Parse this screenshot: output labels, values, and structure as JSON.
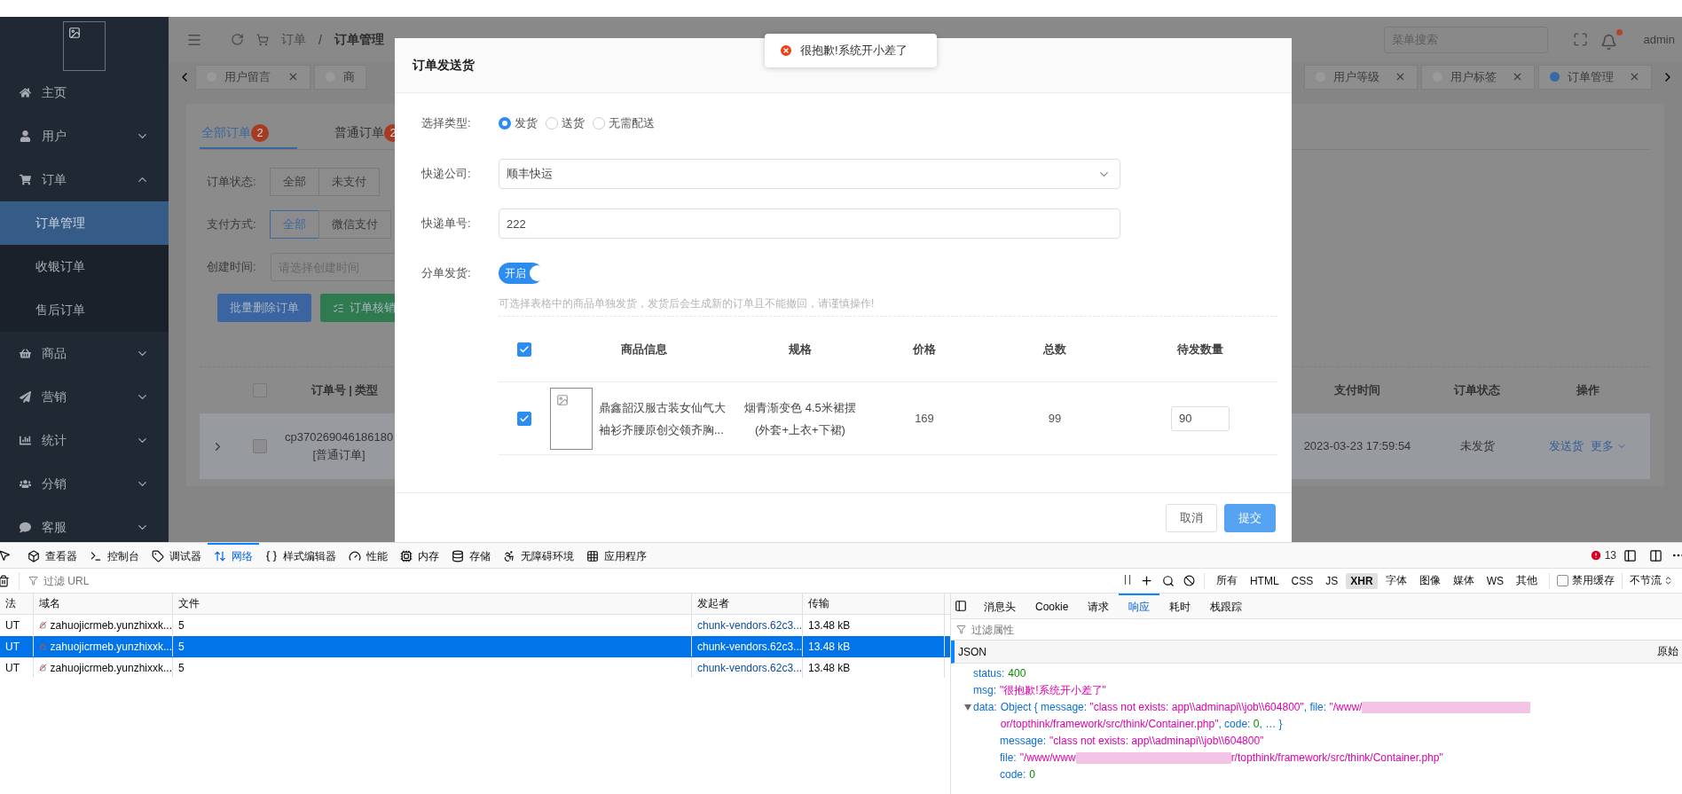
{
  "header": {
    "breadcrumb": {
      "items": [
        "订单",
        "订单管理"
      ],
      "separator": "/"
    },
    "search": {
      "placeholder": "菜单搜索"
    },
    "unread": true,
    "user": "admin"
  },
  "tabs": {
    "left": [
      {
        "label": "用户留言",
        "selected": false
      },
      {
        "label": "商",
        "selected": false
      }
    ],
    "right": [
      {
        "label": "用户等级",
        "selected": false
      },
      {
        "label": "用户标签",
        "selected": false
      },
      {
        "label": "订单管理",
        "selected": true
      }
    ]
  },
  "sidebar": {
    "items": [
      {
        "label": "主页"
      },
      {
        "label": "用户",
        "expanded": false
      },
      {
        "label": "订单",
        "expanded": true,
        "children": [
          {
            "label": "订单管理",
            "selected": true
          },
          {
            "label": "收银订单",
            "selected": false
          },
          {
            "label": "售后订单",
            "selected": false
          }
        ]
      },
      {
        "label": "商品",
        "expanded": false
      },
      {
        "label": "营销",
        "expanded": false
      },
      {
        "label": "统计",
        "expanded": false
      },
      {
        "label": "分销",
        "expanded": false
      },
      {
        "label": "客服",
        "expanded": false
      }
    ]
  },
  "order_page": {
    "tabs": [
      {
        "label": "全部订单",
        "count": "2",
        "selected": true
      },
      {
        "label": "普通订单",
        "count": "2",
        "selected": false
      }
    ],
    "filters": [
      {
        "label": "订单状态:",
        "options": [
          {
            "label": "全部",
            "selected": false
          },
          {
            "label": "未支付",
            "selected": false
          }
        ]
      },
      {
        "label": "支付方式:",
        "options": [
          {
            "label": "全部",
            "selected": true
          },
          {
            "label": "微信支付",
            "selected": false
          }
        ]
      }
    ],
    "date_filter": {
      "label": "创建时间:",
      "placeholder": "请选择创建时间"
    },
    "actions": [
      {
        "label": "批量删除订单",
        "kind": "primary"
      },
      {
        "label": "订单核销",
        "kind": "success"
      }
    ],
    "table": {
      "checked": false,
      "columns_left": [
        "订单号 | 类型"
      ],
      "columns_right": [
        "支付时间",
        "订单状态",
        "操作"
      ],
      "rows": [
        {
          "checked": false,
          "order_no": "cp370269046186180",
          "type": "[普通订单]",
          "pay_time": "2023-03-23 17:59:54",
          "status": "未发货",
          "actions": [
            "发送货",
            "更多"
          ]
        }
      ]
    }
  },
  "dialog": {
    "title": "订单发送货",
    "delivery_type": {
      "label": "选择类型:",
      "options": [
        {
          "label": "发货",
          "selected": true
        },
        {
          "label": "送货",
          "selected": false
        },
        {
          "label": "无需配送",
          "selected": false
        }
      ]
    },
    "courier": {
      "label": "快递公司:",
      "value": "顺丰快运"
    },
    "tracking_no": {
      "label": "快递单号:",
      "value": "222"
    },
    "split": {
      "label": "分单发货:",
      "on": true,
      "text": "开启"
    },
    "hint": "可选择表格中的商品单独发货，发货后会生成新的订单且不能撤回，请谨慎操作!",
    "items": {
      "checked": true,
      "columns": [
        "商品信息",
        "规格",
        "价格",
        "总数",
        "待发数量"
      ],
      "rows": [
        {
          "checked": true,
          "name": "鼎鑫韶汉服古装女仙气大袖衫齐腰原创交领齐胸...",
          "spec": "烟青渐变色 4.5米裙摆\n(外套+上衣+下裙)",
          "price": "169",
          "total": "99",
          "quantity": "90"
        }
      ]
    },
    "buttons": [
      {
        "label": "取消",
        "kind": "default"
      },
      {
        "label": "提交",
        "kind": "primary"
      }
    ]
  },
  "toast": {
    "message": "很抱歉!系统开小差了"
  },
  "devtools": {
    "tools": [
      {
        "label": "查看器",
        "selected": false
      },
      {
        "label": "控制台",
        "selected": false
      },
      {
        "label": "调试器",
        "selected": false
      },
      {
        "label": "网络",
        "selected": true
      },
      {
        "label": "样式编辑器",
        "selected": false
      },
      {
        "label": "性能",
        "selected": false
      },
      {
        "label": "内存",
        "selected": false
      },
      {
        "label": "存储",
        "selected": false
      },
      {
        "label": "无障碍环境",
        "selected": false
      },
      {
        "label": "应用程序",
        "selected": false
      }
    ],
    "error_count": "13",
    "filter": {
      "placeholder": "过滤 URL"
    },
    "type_filters": [
      {
        "label": "所有",
        "selected": false
      },
      {
        "label": "HTML",
        "selected": false
      },
      {
        "label": "CSS",
        "selected": false
      },
      {
        "label": "JS",
        "selected": false
      },
      {
        "label": "XHR",
        "selected": true
      },
      {
        "label": "字体",
        "selected": false
      },
      {
        "label": "图像",
        "selected": false
      },
      {
        "label": "媒体",
        "selected": false
      },
      {
        "label": "WS",
        "selected": false
      },
      {
        "label": "其他",
        "selected": false
      }
    ],
    "disable_cache": {
      "label": "禁用缓存",
      "checked": false
    },
    "throttle": "不节流",
    "requests": {
      "columns": [
        "法",
        "域名",
        "文件",
        "发起者",
        "传输"
      ],
      "rows": [
        {
          "method": "UT",
          "domain": "zahuojicrmeb.yunzhixxk...",
          "file": "5",
          "initiator": "chunk-vendors.62c3...",
          "transfer": "13.48 kB",
          "selected": false
        },
        {
          "method": "UT",
          "domain": "zahuojicrmeb.yunzhixxk...",
          "file": "5",
          "initiator": "chunk-vendors.62c3...",
          "transfer": "13.48 kB",
          "selected": true
        },
        {
          "method": "UT",
          "domain": "zahuojicrmeb.yunzhixxk...",
          "file": "5",
          "initiator": "chunk-vendors.62c3...",
          "transfer": "13.48 kB",
          "selected": false
        }
      ]
    },
    "detail": {
      "tabs": [
        {
          "label": "消息头",
          "selected": false
        },
        {
          "label": "Cookie",
          "selected": false
        },
        {
          "label": "请求",
          "selected": false
        },
        {
          "label": "响应",
          "selected": true
        },
        {
          "label": "耗时",
          "selected": false
        },
        {
          "label": "栈跟踪",
          "selected": false
        }
      ],
      "filter_placeholder": "过滤属性",
      "json_label": "JSON",
      "raw_label": "原始",
      "tree": [
        {
          "key": "status:",
          "value": [
            {
              "kind": "number",
              "text": "400"
            }
          ]
        },
        {
          "key": "msg:",
          "value": [
            {
              "kind": "string",
              "text": "\"很抱歉!系统开小差了\""
            }
          ]
        },
        {
          "key": "data:",
          "expanded": true,
          "value": [
            {
              "kind": "plain",
              "text": "Object { message: "
            },
            {
              "kind": "string",
              "text": "\"class not exists: app\\\\adminapi\\\\job\\\\604800\""
            },
            {
              "kind": "plain",
              "text": ", file: "
            },
            {
              "kind": "string",
              "text": "\"/www/"
            },
            {
              "kind": "redacted"
            },
            {
              "kind": "string",
              "text": "or/topthink/framework/src/think/Container.php\""
            },
            {
              "kind": "plain",
              "text": ", code: "
            },
            {
              "kind": "number",
              "text": "0"
            },
            {
              "kind": "plain",
              "text": ", … }"
            }
          ],
          "children": [
            {
              "key": "message:",
              "value": [
                {
                  "kind": "string",
                  "text": "\"class not exists: app\\\\adminapi\\\\job\\\\604800\""
                }
              ]
            },
            {
              "key": "file:",
              "value": [
                {
                  "kind": "string",
                  "text": "\"/www/www"
                },
                {
                  "kind": "redacted"
                },
                {
                  "kind": "string",
                  "text": "r/topthink/framework/src/think/Container.php\""
                }
              ]
            },
            {
              "key": "code:",
              "value": [
                {
                  "kind": "number",
                  "text": "0"
                }
              ]
            }
          ]
        }
      ]
    }
  }
}
